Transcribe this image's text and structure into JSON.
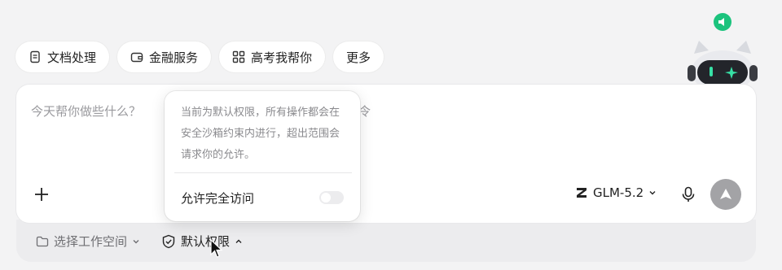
{
  "chips": [
    {
      "label": "文档处理",
      "icon": "document-icon"
    },
    {
      "label": "金融服务",
      "icon": "wallet-icon"
    },
    {
      "label": "高考我帮你",
      "icon": "grid-icon"
    },
    {
      "label": "更多",
      "icon": ""
    }
  ],
  "input": {
    "placeholder": "今天帮你做些什么？",
    "placeholder_tail": "令"
  },
  "model": {
    "label": "GLM-5.2",
    "icon": "z-logo-icon"
  },
  "bottom_bar": {
    "workspace_label": "选择工作空间",
    "permission_label": "默认权限"
  },
  "popover": {
    "description": "当前为默认权限，所有操作都会在安全沙箱约束内进行，超出范围会请求你的允许。",
    "full_access_label": "允许完全访问",
    "full_access_enabled": false
  },
  "colors": {
    "accent": "#1bc37d",
    "send": "#a3a3a6"
  }
}
